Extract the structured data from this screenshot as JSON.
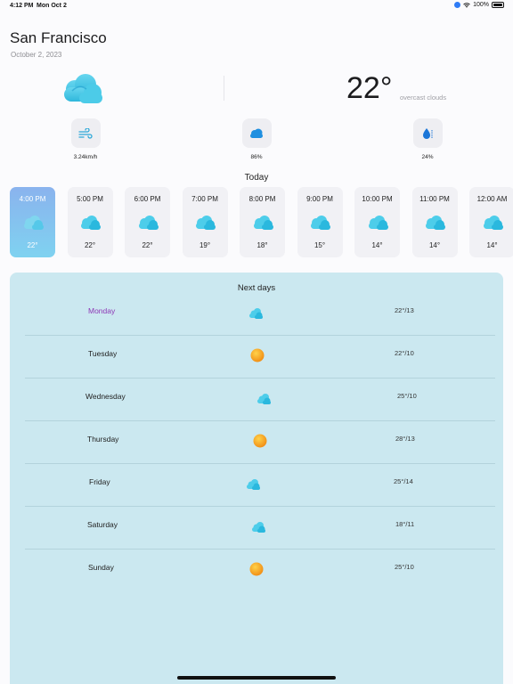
{
  "status_bar": {
    "time": "4:12 PM",
    "date": "Mon Oct 2",
    "battery": "100%"
  },
  "location": {
    "city": "San Francisco",
    "date": "October 2, 2023"
  },
  "current": {
    "temperature": "22°",
    "condition": "overcast clouds",
    "icon": "cloud-icon"
  },
  "metrics": [
    {
      "name": "wind",
      "icon": "wind-icon",
      "value": "3.24km/h"
    },
    {
      "name": "clouds",
      "icon": "cloud-icon",
      "value": "86%"
    },
    {
      "name": "humidity",
      "icon": "droplet-icon",
      "value": "24%"
    }
  ],
  "today": {
    "title": "Today",
    "hours": [
      {
        "time": "4:00 PM",
        "temp": "22°",
        "icon": "cloud-icon",
        "active": true
      },
      {
        "time": "5:00 PM",
        "temp": "22°",
        "icon": "cloud-icon"
      },
      {
        "time": "6:00 PM",
        "temp": "22°",
        "icon": "cloud-icon"
      },
      {
        "time": "7:00 PM",
        "temp": "19°",
        "icon": "cloud-icon"
      },
      {
        "time": "8:00 PM",
        "temp": "18°",
        "icon": "cloud-icon"
      },
      {
        "time": "9:00 PM",
        "temp": "15°",
        "icon": "cloud-icon"
      },
      {
        "time": "10:00 PM",
        "temp": "14°",
        "icon": "cloud-icon"
      },
      {
        "time": "11:00 PM",
        "temp": "14°",
        "icon": "cloud-icon"
      },
      {
        "time": "12:00 AM",
        "temp": "14°",
        "icon": "cloud-icon"
      }
    ]
  },
  "next_days": {
    "title": "Next days",
    "days": [
      {
        "name": "Monday",
        "icon": "cloud-icon",
        "temp": "22°/13",
        "selected": true
      },
      {
        "name": "Tuesday",
        "icon": "sun-icon",
        "temp": "22°/10"
      },
      {
        "name": "Wednesday",
        "icon": "cloud-icon",
        "temp": "25°/10"
      },
      {
        "name": "Thursday",
        "icon": "sun-icon",
        "temp": "28°/13"
      },
      {
        "name": "Friday",
        "icon": "cloud-icon",
        "temp": "25°/14"
      },
      {
        "name": "Saturday",
        "icon": "cloud-icon",
        "temp": "18°/11"
      },
      {
        "name": "Sunday",
        "icon": "sun-icon",
        "temp": "25°/10"
      }
    ]
  },
  "colors": {
    "accent_selected_day": "#8e37b5",
    "cloud": "#3fc6e6",
    "sun": "#f59a1b",
    "card_bg": "#cbe8f0"
  }
}
